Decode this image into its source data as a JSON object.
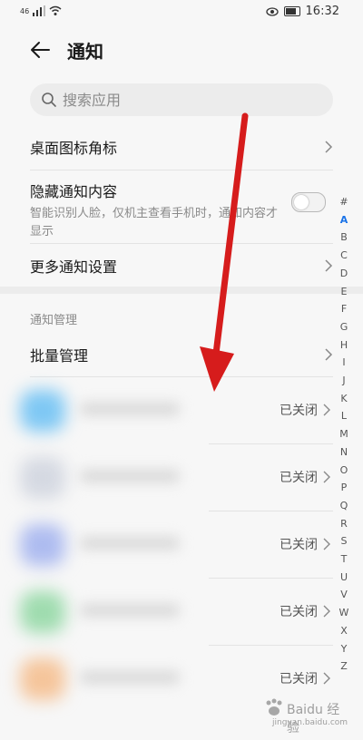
{
  "status_bar": {
    "signal_label": "46",
    "time": "16:32"
  },
  "header": {
    "title": "通知"
  },
  "search": {
    "placeholder": "搜索应用"
  },
  "settings": {
    "badge_label": "桌面图标角标",
    "hide_content_label": "隐藏通知内容",
    "hide_content_desc": "智能识别人脸，仅机主查看手机时，通知内容才显示",
    "hide_content_enabled": false,
    "more_settings_label": "更多通知设置"
  },
  "section": {
    "label": "通知管理"
  },
  "batch": {
    "label": "批量管理"
  },
  "apps": [
    {
      "status": "已关闭",
      "icon_color": "#7fc8f4"
    },
    {
      "status": "已关闭",
      "icon_color": "#d5d9e2"
    },
    {
      "status": "已关闭",
      "icon_color": "#aebcf0"
    },
    {
      "status": "已关闭",
      "icon_color": "#9fdcaf"
    },
    {
      "status": "已关闭",
      "icon_color": "#f5c59b"
    }
  ],
  "alpha_index": [
    "#",
    "A",
    "B",
    "C",
    "D",
    "E",
    "F",
    "G",
    "H",
    "I",
    "J",
    "K",
    "L",
    "M",
    "N",
    "O",
    "P",
    "Q",
    "R",
    "S",
    "T",
    "U",
    "V",
    "W",
    "X",
    "Y",
    "Z"
  ],
  "alpha_active": "A",
  "watermark": {
    "text": "Baidu 经验",
    "url": "jingyan.baidu.com"
  },
  "colors": {
    "annotation_arrow": "#d61c1c",
    "accent": "#1a73e8"
  }
}
